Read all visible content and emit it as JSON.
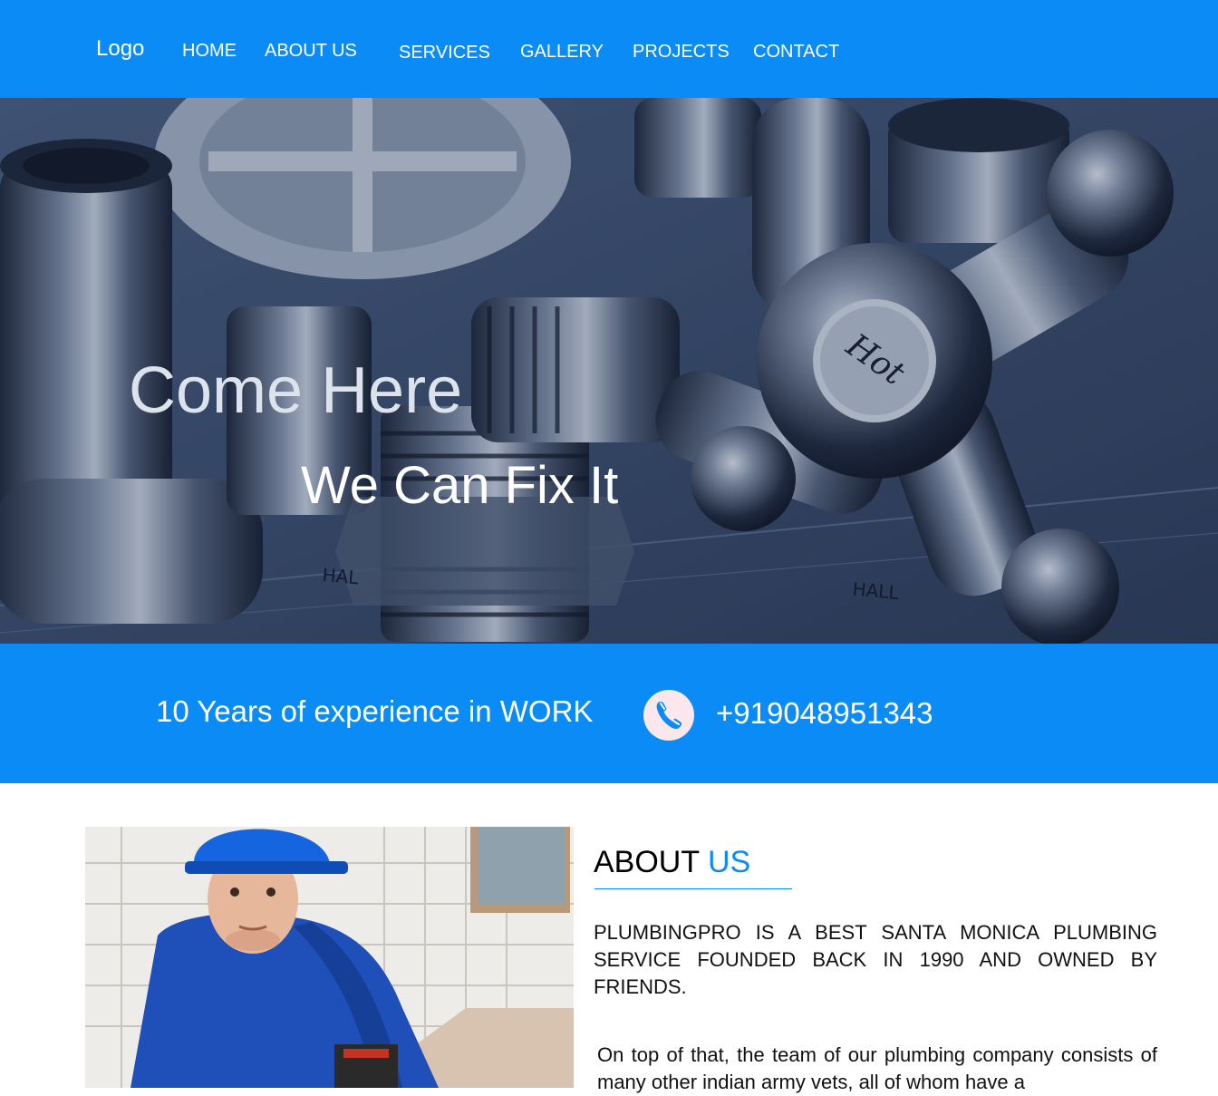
{
  "header": {
    "logo": "Logo",
    "nav": [
      {
        "label": "HOME"
      },
      {
        "label": "ABOUT US"
      },
      {
        "label": "SERVICES"
      },
      {
        "label": "GALLERY"
      },
      {
        "label": "PROJECTS"
      },
      {
        "label": "CONTACT"
      }
    ]
  },
  "hero": {
    "title": "Come Here",
    "subtitle": "We Can Fix It",
    "image_icon": "plumbing-fittings-photo"
  },
  "band": {
    "experience_text": "10 Years of experience in WORK",
    "phone_icon": "phone-icon",
    "phone_number": "+919048951343"
  },
  "about": {
    "heading_main": "ABOUT",
    "heading_accent": "US",
    "paragraph1": "PLUMBINGPRO IS A BEST SANTA MONICA PLUMBING SERVICE FOUNDED BACK IN 1990 AND OWNED BY FRIENDS.",
    "paragraph2": "On top of that, the team of our plumbing company consists of many other indian army vets, all of whom have a",
    "photo_icon": "plumber-photo"
  },
  "colors": {
    "brand_blue": "#0a8bf5",
    "hero_overlay": "#3b4e6c",
    "phone_circle": "#fbe7ec",
    "hero_title": "#dde3ec"
  }
}
